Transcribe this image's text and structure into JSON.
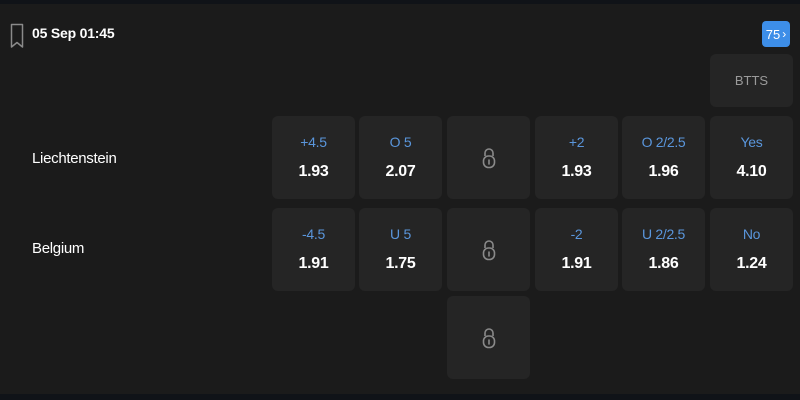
{
  "match": {
    "datetime": "05 Sep 01:45",
    "markets_count": "75"
  },
  "header": {
    "btts_label": "BTTS"
  },
  "teams": [
    {
      "name": "Liechtenstein"
    },
    {
      "name": "Belgium"
    }
  ],
  "rows": [
    [
      {
        "line": "+4.5",
        "odds": "1.93"
      },
      {
        "line": "O 5",
        "odds": "2.07"
      },
      {
        "locked": true
      },
      {
        "line": "+2",
        "odds": "1.93"
      },
      {
        "line": "O 2/2.5",
        "odds": "1.96"
      },
      {
        "line": "Yes",
        "odds": "4.10"
      }
    ],
    [
      {
        "line": "-4.5",
        "odds": "1.91"
      },
      {
        "line": "U 5",
        "odds": "1.75"
      },
      {
        "locked": true
      },
      {
        "line": "-2",
        "odds": "1.91"
      },
      {
        "line": "U 2/2.5",
        "odds": "1.86"
      },
      {
        "line": "No",
        "odds": "1.24"
      }
    ]
  ],
  "extra_row": [
    {
      "locked": true
    }
  ],
  "colors": {
    "background": "#1b1b1b",
    "cell": "#252525",
    "accent": "#3d8ee8",
    "line_text": "#5a96dc",
    "muted": "#9a9a9a"
  },
  "icons": [
    "bookmark-icon",
    "chevron-right-icon",
    "lock-icon"
  ]
}
